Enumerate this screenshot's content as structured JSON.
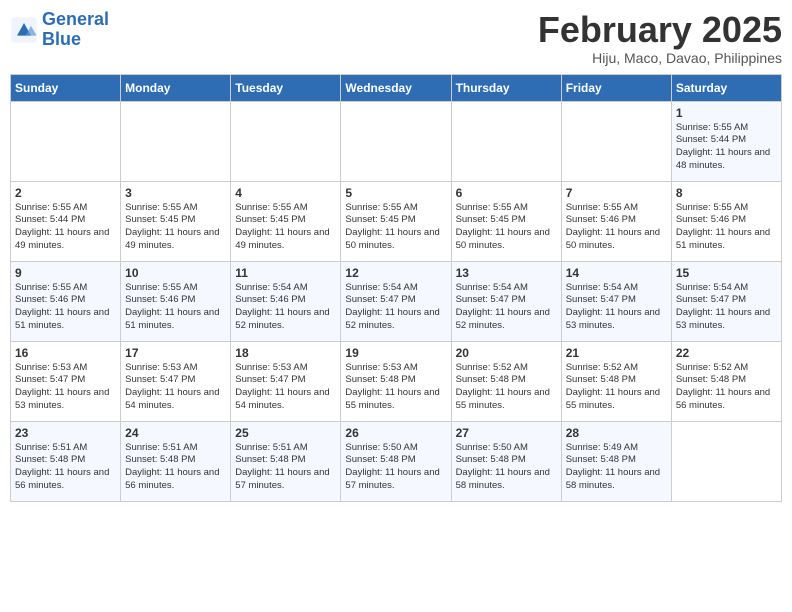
{
  "header": {
    "logo_line1": "General",
    "logo_line2": "Blue",
    "month": "February 2025",
    "location": "Hiju, Maco, Davao, Philippines"
  },
  "weekdays": [
    "Sunday",
    "Monday",
    "Tuesday",
    "Wednesday",
    "Thursday",
    "Friday",
    "Saturday"
  ],
  "weeks": [
    [
      {
        "day": "",
        "info": ""
      },
      {
        "day": "",
        "info": ""
      },
      {
        "day": "",
        "info": ""
      },
      {
        "day": "",
        "info": ""
      },
      {
        "day": "",
        "info": ""
      },
      {
        "day": "",
        "info": ""
      },
      {
        "day": "1",
        "info": "Sunrise: 5:55 AM\nSunset: 5:44 PM\nDaylight: 11 hours and 48 minutes."
      }
    ],
    [
      {
        "day": "2",
        "info": "Sunrise: 5:55 AM\nSunset: 5:44 PM\nDaylight: 11 hours and 49 minutes."
      },
      {
        "day": "3",
        "info": "Sunrise: 5:55 AM\nSunset: 5:45 PM\nDaylight: 11 hours and 49 minutes."
      },
      {
        "day": "4",
        "info": "Sunrise: 5:55 AM\nSunset: 5:45 PM\nDaylight: 11 hours and 49 minutes."
      },
      {
        "day": "5",
        "info": "Sunrise: 5:55 AM\nSunset: 5:45 PM\nDaylight: 11 hours and 50 minutes."
      },
      {
        "day": "6",
        "info": "Sunrise: 5:55 AM\nSunset: 5:45 PM\nDaylight: 11 hours and 50 minutes."
      },
      {
        "day": "7",
        "info": "Sunrise: 5:55 AM\nSunset: 5:46 PM\nDaylight: 11 hours and 50 minutes."
      },
      {
        "day": "8",
        "info": "Sunrise: 5:55 AM\nSunset: 5:46 PM\nDaylight: 11 hours and 51 minutes."
      }
    ],
    [
      {
        "day": "9",
        "info": "Sunrise: 5:55 AM\nSunset: 5:46 PM\nDaylight: 11 hours and 51 minutes."
      },
      {
        "day": "10",
        "info": "Sunrise: 5:55 AM\nSunset: 5:46 PM\nDaylight: 11 hours and 51 minutes."
      },
      {
        "day": "11",
        "info": "Sunrise: 5:54 AM\nSunset: 5:46 PM\nDaylight: 11 hours and 52 minutes."
      },
      {
        "day": "12",
        "info": "Sunrise: 5:54 AM\nSunset: 5:47 PM\nDaylight: 11 hours and 52 minutes."
      },
      {
        "day": "13",
        "info": "Sunrise: 5:54 AM\nSunset: 5:47 PM\nDaylight: 11 hours and 52 minutes."
      },
      {
        "day": "14",
        "info": "Sunrise: 5:54 AM\nSunset: 5:47 PM\nDaylight: 11 hours and 53 minutes."
      },
      {
        "day": "15",
        "info": "Sunrise: 5:54 AM\nSunset: 5:47 PM\nDaylight: 11 hours and 53 minutes."
      }
    ],
    [
      {
        "day": "16",
        "info": "Sunrise: 5:53 AM\nSunset: 5:47 PM\nDaylight: 11 hours and 53 minutes."
      },
      {
        "day": "17",
        "info": "Sunrise: 5:53 AM\nSunset: 5:47 PM\nDaylight: 11 hours and 54 minutes."
      },
      {
        "day": "18",
        "info": "Sunrise: 5:53 AM\nSunset: 5:47 PM\nDaylight: 11 hours and 54 minutes."
      },
      {
        "day": "19",
        "info": "Sunrise: 5:53 AM\nSunset: 5:48 PM\nDaylight: 11 hours and 55 minutes."
      },
      {
        "day": "20",
        "info": "Sunrise: 5:52 AM\nSunset: 5:48 PM\nDaylight: 11 hours and 55 minutes."
      },
      {
        "day": "21",
        "info": "Sunrise: 5:52 AM\nSunset: 5:48 PM\nDaylight: 11 hours and 55 minutes."
      },
      {
        "day": "22",
        "info": "Sunrise: 5:52 AM\nSunset: 5:48 PM\nDaylight: 11 hours and 56 minutes."
      }
    ],
    [
      {
        "day": "23",
        "info": "Sunrise: 5:51 AM\nSunset: 5:48 PM\nDaylight: 11 hours and 56 minutes."
      },
      {
        "day": "24",
        "info": "Sunrise: 5:51 AM\nSunset: 5:48 PM\nDaylight: 11 hours and 56 minutes."
      },
      {
        "day": "25",
        "info": "Sunrise: 5:51 AM\nSunset: 5:48 PM\nDaylight: 11 hours and 57 minutes."
      },
      {
        "day": "26",
        "info": "Sunrise: 5:50 AM\nSunset: 5:48 PM\nDaylight: 11 hours and 57 minutes."
      },
      {
        "day": "27",
        "info": "Sunrise: 5:50 AM\nSunset: 5:48 PM\nDaylight: 11 hours and 58 minutes."
      },
      {
        "day": "28",
        "info": "Sunrise: 5:49 AM\nSunset: 5:48 PM\nDaylight: 11 hours and 58 minutes."
      },
      {
        "day": "",
        "info": ""
      }
    ]
  ]
}
